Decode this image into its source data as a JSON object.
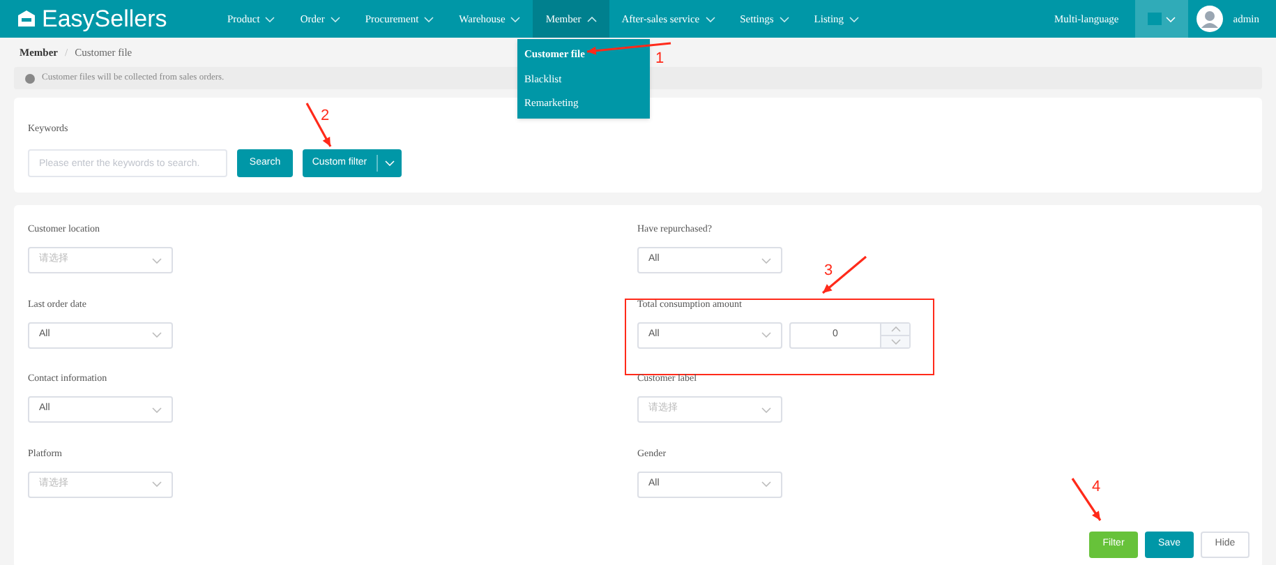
{
  "header": {
    "logo": "EasySellers",
    "nav": [
      {
        "label": "Product",
        "selected": false,
        "expanded": false
      },
      {
        "label": "Order",
        "selected": false,
        "expanded": false
      },
      {
        "label": "Procurement",
        "selected": false,
        "expanded": false
      },
      {
        "label": "Warehouse",
        "selected": false,
        "expanded": false
      },
      {
        "label": "Member",
        "selected": true,
        "expanded": true
      },
      {
        "label": "After-sales service",
        "selected": false,
        "expanded": false
      },
      {
        "label": "Settings",
        "selected": false,
        "expanded": false
      },
      {
        "label": "Listing",
        "selected": false,
        "expanded": false
      }
    ],
    "language": "Multi-language",
    "user": "admin"
  },
  "member_menu": {
    "items": [
      {
        "label": "Customer file",
        "selected": true,
        "annotation": "1"
      },
      {
        "label": "Blacklist",
        "selected": false
      },
      {
        "label": "Remarketing",
        "selected": false
      }
    ]
  },
  "breadcrumb": [
    "Member",
    "Customer file"
  ],
  "breadcrumb_separator": "/",
  "notice": "Customer files will be collected from sales orders.",
  "search": {
    "label": "Keywords",
    "placeholder": "Please enter the keywords to search.",
    "search_button": "Search",
    "filter_button": "Custom filter",
    "filter_annotation": "2"
  },
  "filters": [
    {
      "label": "Customer location",
      "kind": "select",
      "placeholder": "请选择"
    },
    {
      "label": "Have repurchased?",
      "kind": "select",
      "value": "All"
    },
    {
      "label": "Last order date",
      "kind": "select",
      "value": "All"
    },
    {
      "label": "Total consumption amount",
      "kind": "select_number",
      "value": "All",
      "number": "0",
      "highlighted": true
    },
    {
      "label": "Contact information",
      "kind": "select",
      "value": "All"
    },
    {
      "label": "Customer label",
      "kind": "select",
      "placeholder": "请选择"
    },
    {
      "label": "Platform",
      "kind": "select",
      "placeholder": "请选择"
    },
    {
      "label": "Gender",
      "kind": "select",
      "value": "All"
    }
  ],
  "amount_annotation": "3",
  "actions": [
    {
      "label": "Filter",
      "kind": "primary",
      "annotation": "4"
    },
    {
      "label": "Save",
      "kind": "secondary"
    },
    {
      "label": "Hide",
      "kind": "plain"
    }
  ]
}
